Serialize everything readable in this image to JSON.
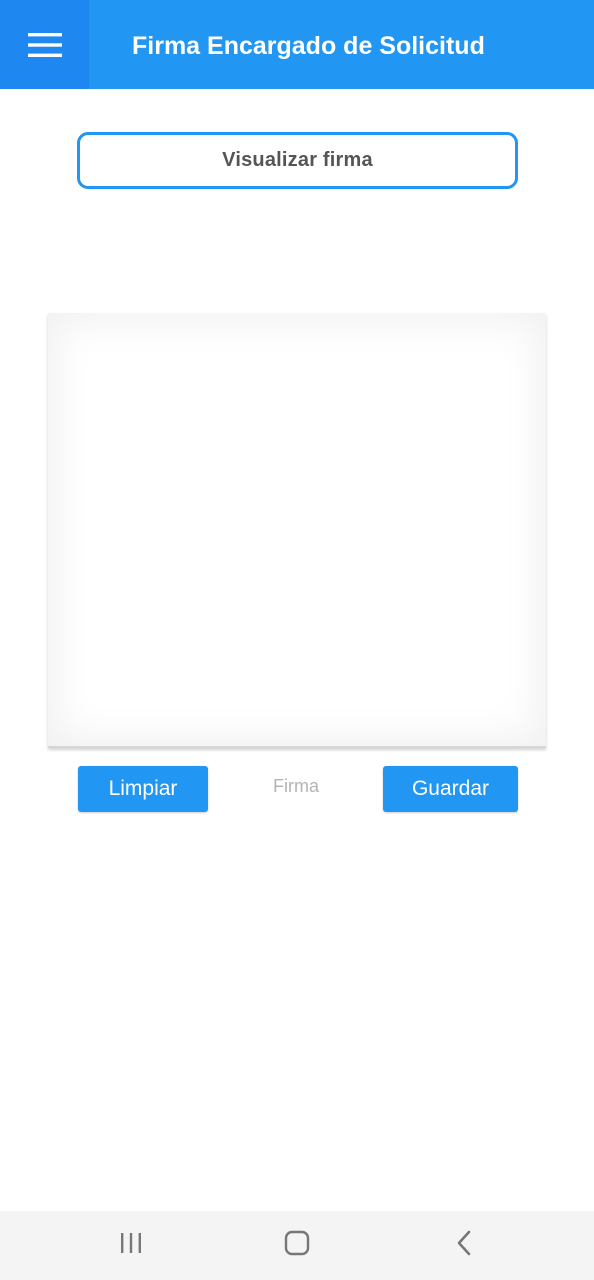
{
  "app_bar": {
    "title": "Firma Encargado de Solicitud",
    "menu_icon": "hamburger-menu-icon",
    "color": "#2196F3",
    "menu_button_color": "#1E88F0"
  },
  "visualize_button": {
    "label": "Visualizar firma"
  },
  "signature_pad": {
    "caption": "Firma"
  },
  "actions": {
    "clear_label": "Limpiar",
    "save_label": "Guardar"
  },
  "system_nav": {
    "recent_icon": "recent-apps-icon",
    "home_icon": "home-icon",
    "back_icon": "back-icon"
  }
}
